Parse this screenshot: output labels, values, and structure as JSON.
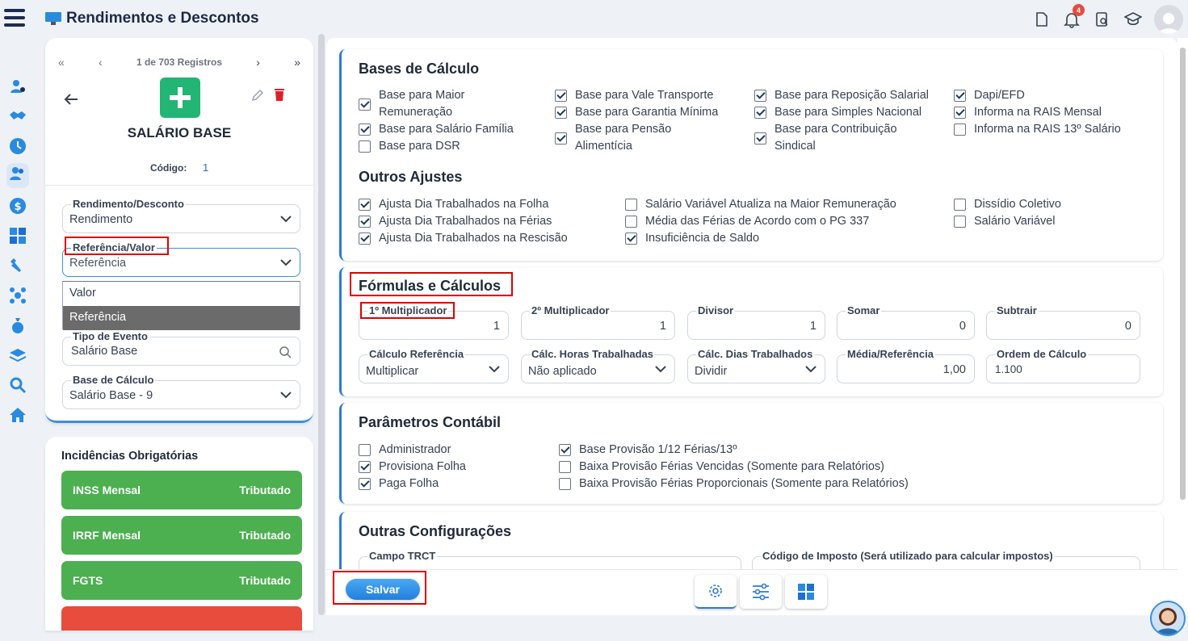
{
  "app": {
    "title": "Rendimentos e Descontos"
  },
  "topbar": {
    "notification_count": "4"
  },
  "record": {
    "pager_label": "1 de 703 Registros",
    "name": "SALÁRIO BASE",
    "codigo_label": "Código:",
    "codigo_value": "1"
  },
  "form": {
    "rendimento_label": "Rendimento/Desconto",
    "rendimento_value": "Rendimento",
    "referencia_label": "Referência/Valor",
    "referencia_value": "Referência",
    "dropdown_options": [
      "Valor",
      "Referência"
    ],
    "tipo_label": "Tipo de Evento",
    "tipo_value": "Salário Base",
    "base_label": "Base de Cálculo",
    "base_value": "Salário Base - 9"
  },
  "incidencias": {
    "title": "Incidências Obrigatórias",
    "items": [
      {
        "name": "INSS Mensal",
        "status": "Tributado"
      },
      {
        "name": "IRRF Mensal",
        "status": "Tributado"
      },
      {
        "name": "FGTS",
        "status": "Tributado"
      }
    ]
  },
  "bases": {
    "title": "Bases de Cálculo",
    "col1": [
      {
        "label": "Base para Maior",
        "label2": "Remuneração",
        "checked": true
      },
      {
        "label": "Base para Salário Família",
        "checked": true
      },
      {
        "label": "Base para DSR",
        "checked": false
      }
    ],
    "col2": [
      {
        "label": "Base para Vale Transporte",
        "checked": true
      },
      {
        "label": "Base para Garantia Mínima",
        "checked": true
      },
      {
        "label": "Base para Pensão",
        "label2": "Alimentícia",
        "checked": true
      }
    ],
    "col3": [
      {
        "label": "Base para Reposição Salarial",
        "checked": true
      },
      {
        "label": "Base para Simples Nacional",
        "checked": true
      },
      {
        "label": "Base para Contribuição",
        "label2": "Sindical",
        "checked": true
      }
    ],
    "col4": [
      {
        "label": "Dapi/EFD",
        "checked": true
      },
      {
        "label": "Informa na RAIS Mensal",
        "checked": true
      },
      {
        "label": "Informa na RAIS 13º Salário",
        "checked": false
      }
    ]
  },
  "ajustes": {
    "title": "Outros Ajustes",
    "col1": [
      {
        "label": "Ajusta Dia Trabalhados na Folha",
        "checked": true
      },
      {
        "label": "Ajusta Dia Trabalhados na Férias",
        "checked": true
      },
      {
        "label": "Ajusta Dia Trabalhados na Rescisão",
        "checked": true
      }
    ],
    "col2": [
      {
        "label": "Salário Variável Atualiza na Maior Remuneração",
        "checked": false
      },
      {
        "label": "Média das Férias de Acordo com o PG 337",
        "checked": false
      },
      {
        "label": "Insuficiência de Saldo",
        "checked": true
      }
    ],
    "col3": [
      {
        "label": "Dissídio Coletivo",
        "checked": false
      },
      {
        "label": "Salário Variável",
        "checked": false
      }
    ]
  },
  "formulas": {
    "title": "Fórmulas e Cálculos",
    "mult1_label": "1º Multiplicador",
    "mult1_value": "1",
    "mult2_label": "2º Multiplicador",
    "mult2_value": "1",
    "divisor_label": "Divisor",
    "divisor_value": "1",
    "somar_label": "Somar",
    "somar_value": "0",
    "subtrair_label": "Subtrair",
    "subtrair_value": "0",
    "calc_ref_label": "Cálculo Referência",
    "calc_ref_value": "Multiplicar",
    "horas_label": "Cálc. Horas Trabalhadas",
    "horas_value": "Não aplicado",
    "dias_label": "Cálc. Dias Trabalhados",
    "dias_value": "Dividir",
    "media_label": "Média/Referência",
    "media_value": "1,00",
    "ordem_label": "Ordem de Cálculo",
    "ordem_value": "1.100"
  },
  "contabil": {
    "title": "Parâmetros Contábil",
    "col1": [
      {
        "label": "Administrador",
        "checked": false
      },
      {
        "label": "Provisiona Folha",
        "checked": true
      },
      {
        "label": "Paga Folha",
        "checked": true
      }
    ],
    "col2": [
      {
        "label": "Base Provisão 1/12 Férias/13º",
        "checked": true
      },
      {
        "label": "Baixa Provisão Férias Vencidas (Somente para Relatórios)",
        "checked": false
      },
      {
        "label": "Baixa Provisão Férias Proporcionais (Somente para Relatórios)",
        "checked": false
      }
    ]
  },
  "outras": {
    "title": "Outras Configurações",
    "trct_label": "Campo TRCT",
    "imposto_label": "Código de Imposto (Será utilizado para calcular impostos)"
  },
  "actions": {
    "save_label": "Salvar"
  }
}
